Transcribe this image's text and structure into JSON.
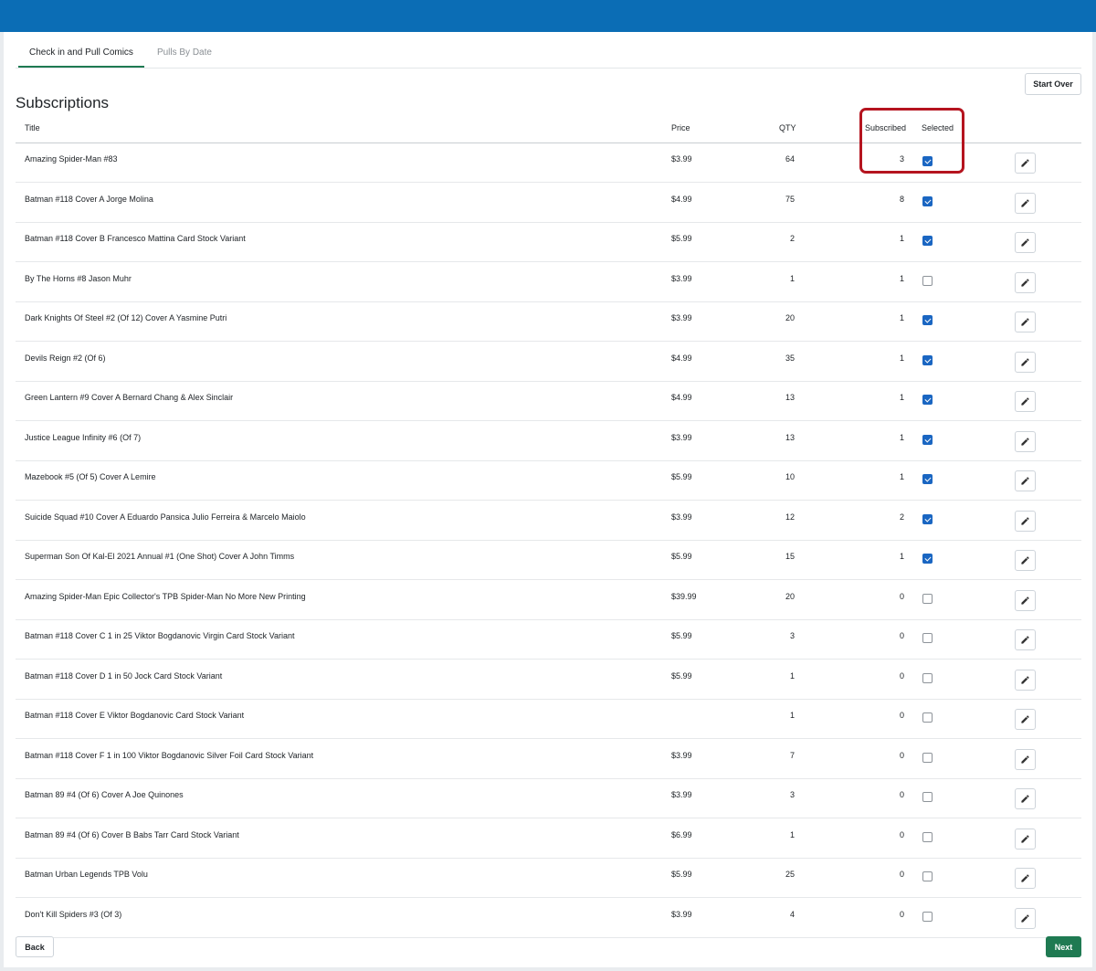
{
  "tabs": [
    {
      "label": "Check in and Pull Comics"
    },
    {
      "label": "Pulls By Date"
    }
  ],
  "start_over_label": "Start Over",
  "page_title": "Subscriptions",
  "columns": {
    "title": "Title",
    "price": "Price",
    "qty": "QTY",
    "subscribed": "Subscribed",
    "selected": "Selected"
  },
  "rows": [
    {
      "title": "Amazing Spider-Man #83",
      "price": "$3.99",
      "qty": "64",
      "subscribed": "3",
      "selected": true
    },
    {
      "title": "Batman #118 Cover A Jorge Molina",
      "price": "$4.99",
      "qty": "75",
      "subscribed": "8",
      "selected": true
    },
    {
      "title": "Batman #118 Cover B Francesco Mattina Card Stock Variant",
      "price": "$5.99",
      "qty": "2",
      "subscribed": "1",
      "selected": true
    },
    {
      "title": "By The Horns #8 Jason Muhr",
      "price": "$3.99",
      "qty": "1",
      "subscribed": "1",
      "selected": false
    },
    {
      "title": "Dark Knights Of Steel #2 (Of 12) Cover A Yasmine Putri",
      "price": "$3.99",
      "qty": "20",
      "subscribed": "1",
      "selected": true
    },
    {
      "title": "Devils Reign #2 (Of 6)",
      "price": "$4.99",
      "qty": "35",
      "subscribed": "1",
      "selected": true
    },
    {
      "title": "Green Lantern #9 Cover A Bernard Chang & Alex Sinclair",
      "price": "$4.99",
      "qty": "13",
      "subscribed": "1",
      "selected": true
    },
    {
      "title": "Justice League Infinity #6 (Of 7)",
      "price": "$3.99",
      "qty": "13",
      "subscribed": "1",
      "selected": true
    },
    {
      "title": "Mazebook #5 (Of 5) Cover A Lemire",
      "price": "$5.99",
      "qty": "10",
      "subscribed": "1",
      "selected": true
    },
    {
      "title": "Suicide Squad #10 Cover A Eduardo Pansica Julio Ferreira & Marcelo Maiolo",
      "price": "$3.99",
      "qty": "12",
      "subscribed": "2",
      "selected": true
    },
    {
      "title": "Superman Son Of Kal-El 2021 Annual #1 (One Shot) Cover A John Timms",
      "price": "$5.99",
      "qty": "15",
      "subscribed": "1",
      "selected": true
    },
    {
      "title": "Amazing Spider-Man Epic Collector's TPB Spider-Man No More New Printing",
      "price": "$39.99",
      "qty": "20",
      "subscribed": "0",
      "selected": false
    },
    {
      "title": "Batman #118 Cover C 1 in 25 Viktor Bogdanovic Virgin Card Stock Variant",
      "price": "$5.99",
      "qty": "3",
      "subscribed": "0",
      "selected": false
    },
    {
      "title": "Batman #118 Cover D 1 in 50 Jock Card Stock Variant",
      "price": "$5.99",
      "qty": "1",
      "subscribed": "0",
      "selected": false
    },
    {
      "title": "Batman #118 Cover E Viktor Bogdanovic Card Stock Variant",
      "price": "",
      "qty": "1",
      "subscribed": "0",
      "selected": false
    },
    {
      "title": "Batman #118 Cover F 1 in 100 Viktor Bogdanovic Silver Foil Card Stock Variant",
      "price": "$3.99",
      "qty": "7",
      "subscribed": "0",
      "selected": false
    },
    {
      "title": "Batman 89 #4 (Of 6) Cover A Joe Quinones",
      "price": "$3.99",
      "qty": "3",
      "subscribed": "0",
      "selected": false
    },
    {
      "title": "Batman 89 #4 (Of 6) Cover B Babs Tarr Card Stock Variant",
      "price": "$6.99",
      "qty": "1",
      "subscribed": "0",
      "selected": false
    },
    {
      "title": "Batman Urban Legends TPB Volu",
      "price": "$5.99",
      "qty": "25",
      "subscribed": "0",
      "selected": false
    },
    {
      "title": "Don't Kill Spiders #3 (Of 3)",
      "price": "$3.99",
      "qty": "4",
      "subscribed": "0",
      "selected": false
    }
  ],
  "footer": {
    "back_label": "Back",
    "next_label": "Next"
  },
  "colors": {
    "header_bar": "#0b6db5",
    "accent_green": "#1f7a52",
    "checkbox_blue": "#1a66c2",
    "highlight_red": "#b5141f"
  }
}
